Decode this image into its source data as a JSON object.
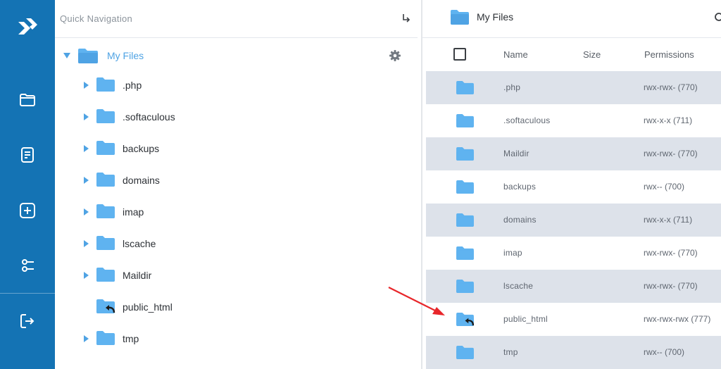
{
  "colors": {
    "rail": "#1473b4",
    "folder": "#5fb3f0",
    "accent": "#4fa3e4",
    "row_shade": "#dde2ea",
    "arrow": "#e8262a"
  },
  "rail": {
    "items": [
      {
        "icon": "logo-icon"
      },
      {
        "icon": "folder-icon"
      },
      {
        "icon": "document-icon"
      },
      {
        "icon": "add-icon"
      },
      {
        "icon": "settings-sliders-icon"
      },
      {
        "icon": "logout-icon"
      }
    ]
  },
  "tree": {
    "quick_nav_label": "Quick Navigation",
    "root_label": "My Files",
    "items": [
      {
        "label": ".php",
        "expandable": true
      },
      {
        "label": ".softaculous",
        "expandable": true
      },
      {
        "label": "backups",
        "expandable": true
      },
      {
        "label": "domains",
        "expandable": true
      },
      {
        "label": "imap",
        "expandable": true
      },
      {
        "label": "lscache",
        "expandable": true
      },
      {
        "label": "Maildir",
        "expandable": true
      },
      {
        "label": "public_html",
        "expandable": false,
        "link": true
      },
      {
        "label": "tmp",
        "expandable": true
      }
    ]
  },
  "list": {
    "title": "My Files",
    "columns": {
      "name": "Name",
      "size": "Size",
      "permissions": "Permissions"
    },
    "rows": [
      {
        "name": ".php",
        "permissions": "rwx-rwx- (770)",
        "link": false
      },
      {
        "name": ".softaculous",
        "permissions": "rwx-x-x (711)",
        "link": false
      },
      {
        "name": "Maildir",
        "permissions": "rwx-rwx- (770)",
        "link": false
      },
      {
        "name": "backups",
        "permissions": "rwx-- (700)",
        "link": false
      },
      {
        "name": "domains",
        "permissions": "rwx-x-x (711)",
        "link": false
      },
      {
        "name": "imap",
        "permissions": "rwx-rwx- (770)",
        "link": false
      },
      {
        "name": "lscache",
        "permissions": "rwx-rwx- (770)",
        "link": false
      },
      {
        "name": "public_html",
        "permissions": "rwx-rwx-rwx (777)",
        "link": true
      },
      {
        "name": "tmp",
        "permissions": "rwx-- (700)",
        "link": false
      }
    ]
  }
}
